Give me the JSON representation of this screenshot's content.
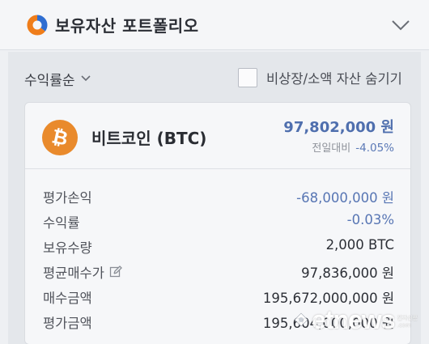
{
  "header": {
    "title": "보유자산 포트폴리오",
    "logo_icon": "portfolio-donut-icon",
    "collapse_icon": "chevron-down-icon"
  },
  "toolbar": {
    "sort_label": "수익률순",
    "hide_small_label": "비상장/소액 자산 숨기기",
    "hide_small_checked": false
  },
  "asset": {
    "name": "비트코인 (BTC)",
    "icon": "bitcoin-icon",
    "price": "97,802,000 원",
    "change_label": "전일대비",
    "change": "-4.05%",
    "rows": [
      {
        "label": "평가손익",
        "value": "-68,000,000 원"
      },
      {
        "label": "수익률",
        "value": "-0.03%"
      },
      {
        "label": "보유수량",
        "value": "2,000 BTC"
      },
      {
        "label": "평균매수가",
        "value": "97,836,000 원"
      },
      {
        "label": "매수금액",
        "value": "195,672,000,000 원"
      },
      {
        "label": "평가금액",
        "value": "195,604,000,000 원"
      }
    ]
  },
  "watermark": {
    "text": "etnews",
    "sub1": "전자신문",
    "sub2": ".com"
  },
  "colors": {
    "accent_blue": "#4f6fae",
    "bitcoin_orange": "#e98a2c",
    "background": "#eef0f3"
  }
}
